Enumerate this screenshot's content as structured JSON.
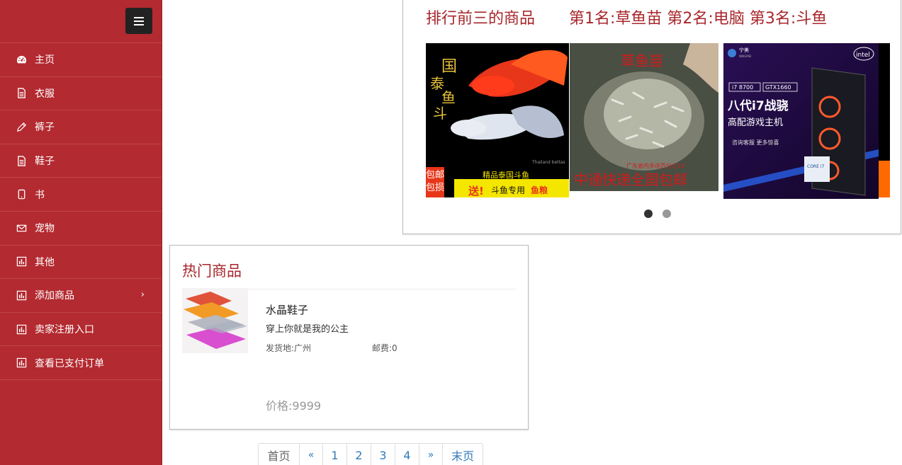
{
  "sidebar": {
    "items": [
      {
        "label": "主页",
        "icon": "dashboard-icon"
      },
      {
        "label": "衣服",
        "icon": "document-icon"
      },
      {
        "label": "裤子",
        "icon": "pencil-icon"
      },
      {
        "label": "鞋子",
        "icon": "document-icon"
      },
      {
        "label": "书",
        "icon": "tablet-icon"
      },
      {
        "label": "宠物",
        "icon": "envelope-icon"
      },
      {
        "label": "其他",
        "icon": "bar-chart-icon"
      },
      {
        "label": "添加商品",
        "icon": "bar-chart-icon",
        "has_submenu": true
      },
      {
        "label": "卖家注册入口",
        "icon": "bar-chart-icon"
      },
      {
        "label": "查看已支付订单",
        "icon": "bar-chart-icon"
      }
    ]
  },
  "carousel": {
    "title": "排行前三的商品",
    "rankings": "第1名:草鱼苗 第2名:电脑 第3名:斗鱼",
    "slide1": {
      "big_text": "国泰鱼斗",
      "caption": "精品泰国斗鱼",
      "promo": "送!",
      "promo_text": "斗鱼专用",
      "promo_highlight": "鱼粮",
      "side": "包邮",
      "side2": "包损",
      "watermark": "Thailand bettas"
    },
    "slide2": {
      "title": "草鱼苗",
      "subtitle": "广东省内多送百分之10",
      "bottom": "中通快递全国包邮"
    },
    "slide3": {
      "brand": "宁美",
      "brand_sub": "NINGMEI",
      "intel": "intel",
      "chip1": "i7 8700",
      "chip2": "GTX1660",
      "headline": "八代i7战骁",
      "sub": "高配游戏主机",
      "cta": "咨询客服  更多惊喜",
      "badge": "CORE i7"
    },
    "edge_text": "包",
    "dots": 2,
    "active_dot": 0
  },
  "hot": {
    "title": "热门商品",
    "product": {
      "name": "水晶鞋子",
      "desc": "穿上你就是我的公主",
      "origin": "发货地:广州",
      "postage": "邮费:0",
      "price": "价格:9999"
    }
  },
  "pagination": {
    "first": "首页",
    "prev": "«",
    "pages": [
      "1",
      "2",
      "3",
      "4"
    ],
    "next": "»",
    "last": "末页"
  },
  "colors": {
    "sidebar": "#b32a30",
    "heading": "#a8262b",
    "link": "#337ab7"
  }
}
